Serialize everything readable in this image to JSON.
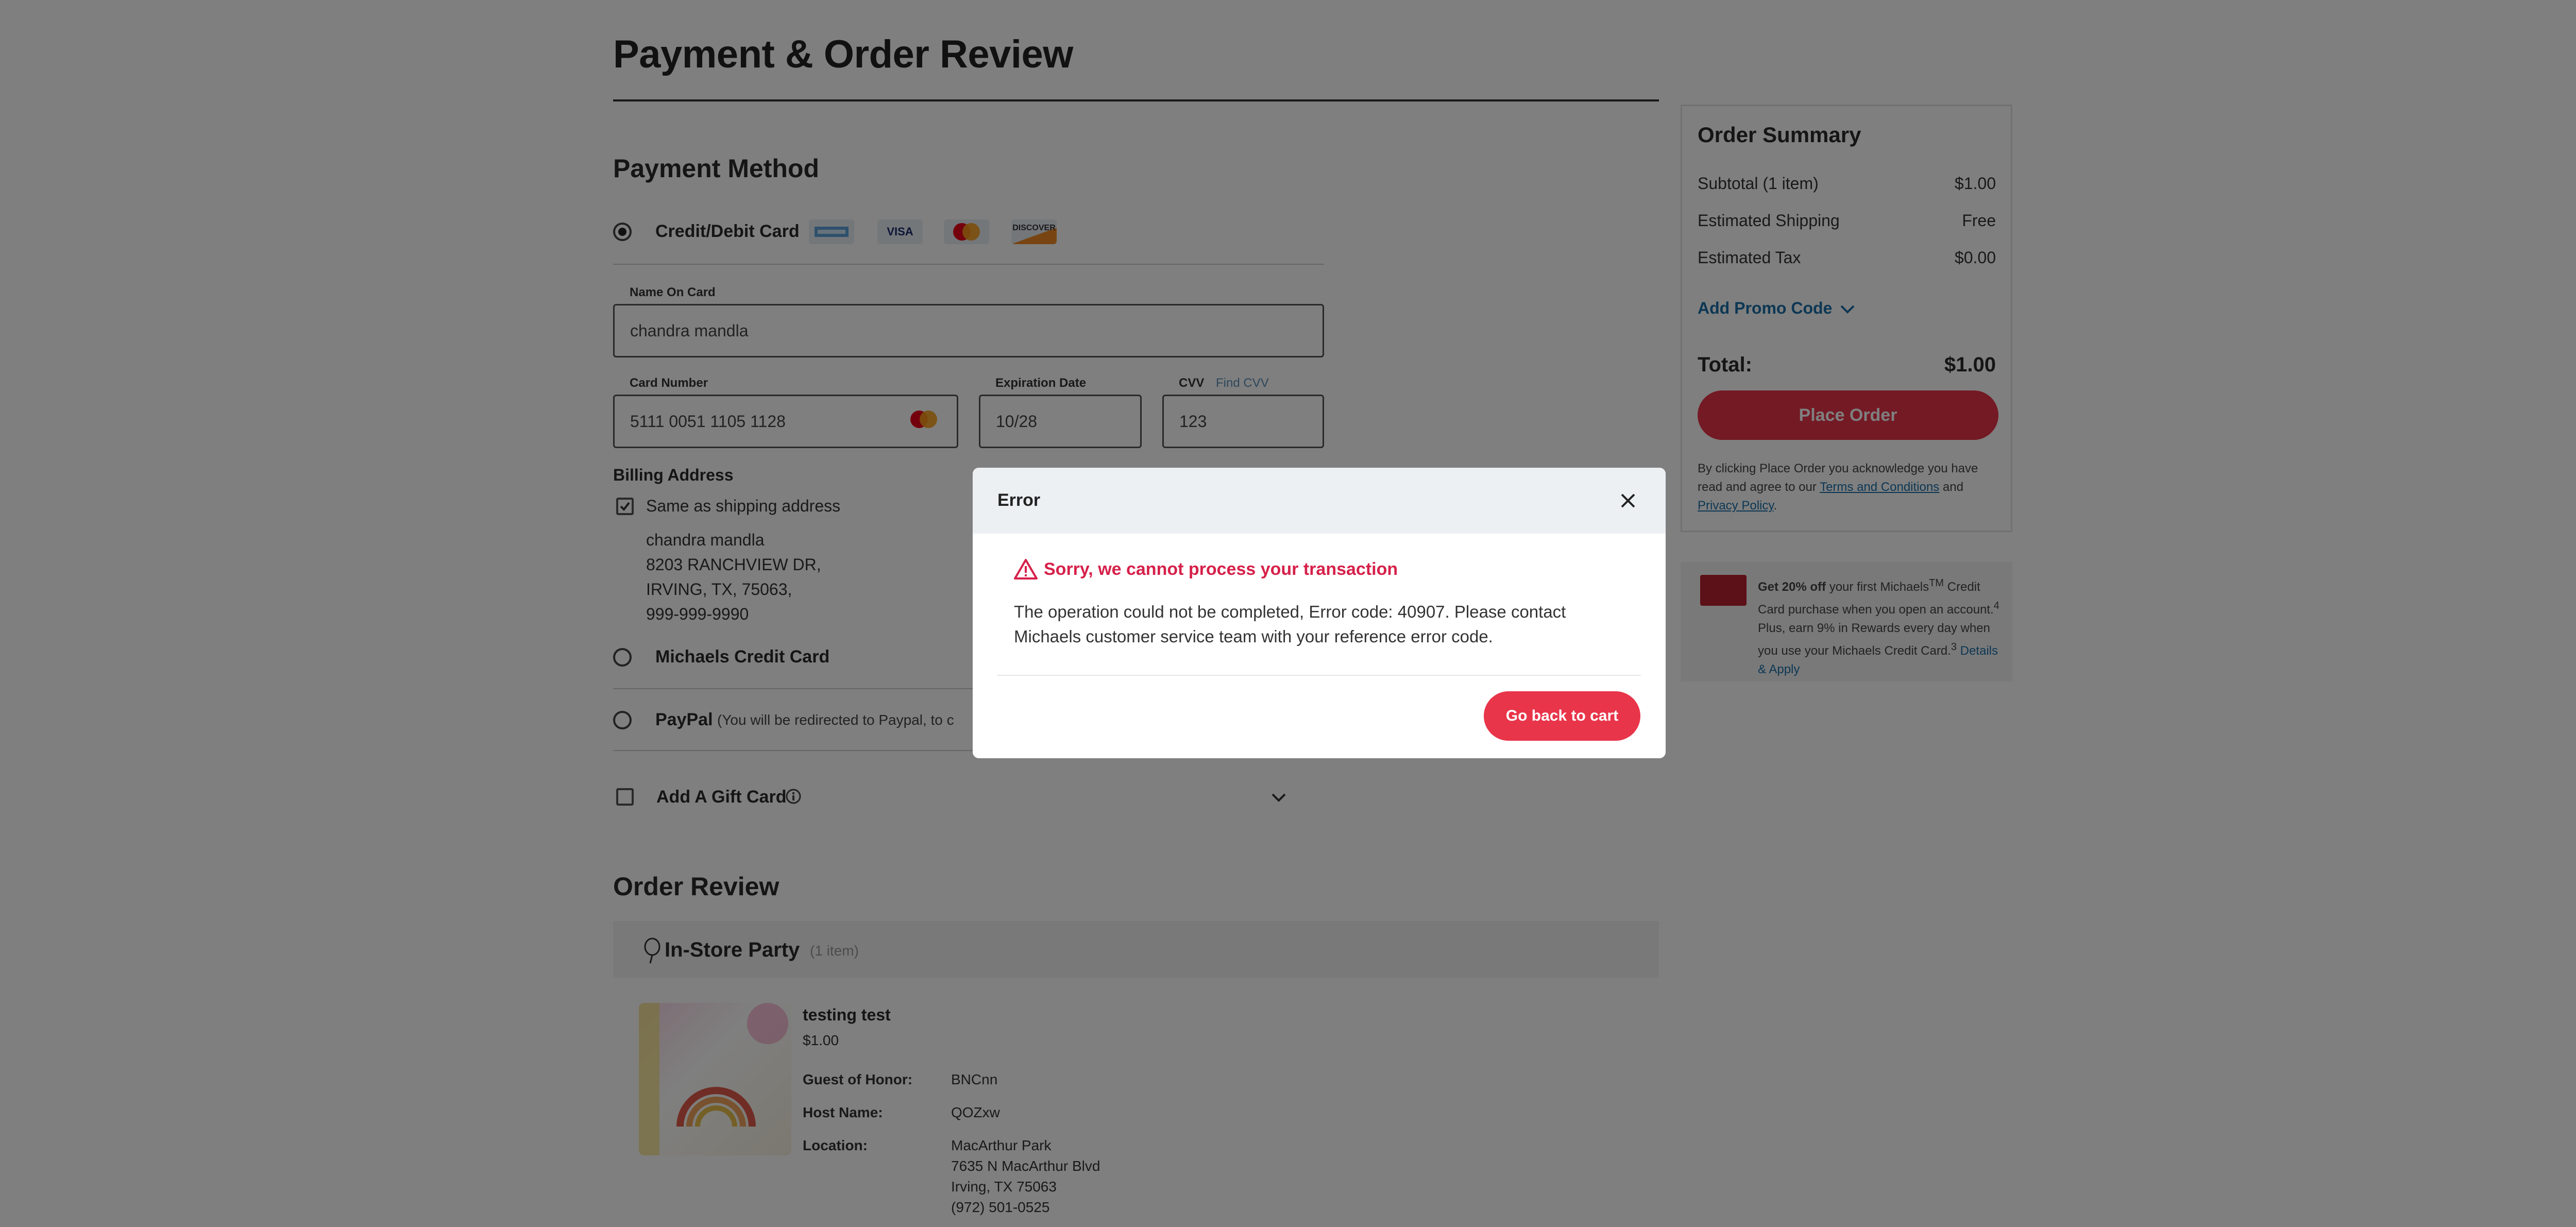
{
  "page": {
    "title": "Payment & Order Review"
  },
  "payment": {
    "section_title": "Payment Method",
    "credit_label": "Credit/Debit Card",
    "card_logos": {
      "visa": "VISA",
      "discover": "DISCOVER"
    },
    "name_label": "Name On Card",
    "name_value": "chandra mandla",
    "number_label": "Card Number",
    "number_value": "5111 0051 1105 1128",
    "exp_label": "Expiration Date",
    "exp_value": "10/28",
    "cvv_label": "CVV",
    "find_cvv": "Find CVV",
    "cvv_value": "123",
    "billing_title": "Billing Address",
    "same_as_shipping": "Same as shipping address",
    "address": [
      "chandra mandla",
      "8203 RANCHVIEW DR,",
      "IRVING, TX, 75063,",
      "999-999-9990"
    ],
    "michaels_card": "Michaels Credit Card",
    "paypal": "PayPal",
    "paypal_note": "(You will be redirected to Paypal, to c",
    "gift_card": "Add A Gift Card"
  },
  "order_review": {
    "title": "Order Review",
    "party_title": "In-Store Party",
    "party_count": "(1 item)",
    "product_name": "testing test",
    "product_price": "$1.00",
    "honor_label": "Guest of Honor:",
    "honor_value": "BNCnn",
    "host_label": "Host Name:",
    "host_value": "QOZxw",
    "location_label": "Location:",
    "location_lines": [
      "MacArthur Park",
      "7635 N MacArthur Blvd",
      "Irving, TX 75063",
      "(972) 501-0525"
    ]
  },
  "summary": {
    "title": "Order Summary",
    "subtotal_label": "Subtotal (1 item)",
    "subtotal_value": "$1.00",
    "shipping_label": "Estimated Shipping",
    "shipping_value": "Free",
    "tax_label": "Estimated Tax",
    "tax_value": "$0.00",
    "promo_label": "Add Promo Code",
    "total_label": "Total:",
    "total_value": "$1.00",
    "place_order": "Place Order",
    "legal_prefix": "By clicking Place Order you acknowledge you have read and agree to our",
    "terms_link": "Terms and Conditions",
    "legal_and": "and",
    "privacy_link": "Privacy Policy",
    "promo_bold": "Get 20% off",
    "promo_text_1": "your first Michaels",
    "promo_tm": "TM",
    "promo_text_2": "Credit Card purchase when you open an account.",
    "promo_sup_4": "4",
    "promo_text_3": "Plus, earn 9% in Rewards every day when you use your Michaels Credit Card.",
    "promo_sup_3": "3",
    "details_link": "Details & Apply"
  },
  "modal": {
    "title": "Error",
    "heading": "Sorry, we cannot process your transaction",
    "body": "The operation could not be completed, Error code: 40907. Please contact Michaels customer service team with your reference error code.",
    "button": "Go back to cart"
  },
  "colors": {
    "accent": "#e8354a",
    "link": "#1a6fa8",
    "error": "#d6214a"
  }
}
